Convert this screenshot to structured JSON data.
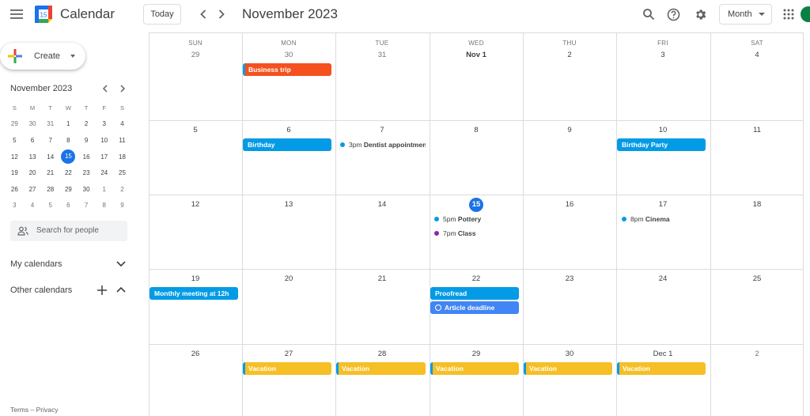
{
  "app": {
    "title": "Calendar",
    "logo_day": "15"
  },
  "toolbar": {
    "today_label": "Today",
    "period_title": "November 2023",
    "view_label": "Month"
  },
  "sidebar": {
    "create_label": "Create",
    "mini_calendar": {
      "title": "November 2023",
      "weekdays": [
        "S",
        "M",
        "T",
        "W",
        "T",
        "F",
        "S"
      ],
      "weeks": [
        [
          "29",
          "30",
          "31",
          "1",
          "2",
          "3",
          "4"
        ],
        [
          "5",
          "6",
          "7",
          "8",
          "9",
          "10",
          "11"
        ],
        [
          "12",
          "13",
          "14",
          "15",
          "16",
          "17",
          "18"
        ],
        [
          "19",
          "20",
          "21",
          "22",
          "23",
          "24",
          "25"
        ],
        [
          "26",
          "27",
          "28",
          "29",
          "30",
          "1",
          "2"
        ],
        [
          "3",
          "4",
          "5",
          "6",
          "7",
          "8",
          "9"
        ]
      ],
      "today": "15"
    },
    "search_people_placeholder": "Search for people",
    "my_calendars_label": "My calendars",
    "other_calendars_label": "Other calendars",
    "footer_terms": "Terms",
    "footer_sep": "–",
    "footer_privacy": "Privacy"
  },
  "month": {
    "weekday_headers": [
      "SUN",
      "MON",
      "TUE",
      "WED",
      "THU",
      "FRI",
      "SAT"
    ],
    "weeks": [
      [
        "29",
        "30",
        "31",
        "Nov 1",
        "2",
        "3",
        "4"
      ],
      [
        "5",
        "6",
        "7",
        "8",
        "9",
        "10",
        "11"
      ],
      [
        "12",
        "13",
        "14",
        "15",
        "16",
        "17",
        "18"
      ],
      [
        "19",
        "20",
        "21",
        "22",
        "23",
        "24",
        "25"
      ],
      [
        "26",
        "27",
        "28",
        "29",
        "30",
        "Dec 1",
        "2"
      ]
    ],
    "today_label": "15",
    "events": {
      "business_trip": "Business trip",
      "birthday": "Birthday",
      "dentist_time": "3pm",
      "dentist_title": "Dentist appointment",
      "birthday_party": "Birthday Party",
      "pottery_time": "5pm",
      "pottery_title": "Pottery",
      "class_time": "7pm",
      "class_title": "Class",
      "cinema_time": "8pm",
      "cinema_title": "Cinema",
      "monthly_meeting": "Monthly meeting at 12h",
      "proofread": "Proofread",
      "article_deadline": "Article deadline",
      "vacation": "Vacation"
    }
  },
  "colors": {
    "today_blue": "#1a73e8",
    "peacock": "#039be5",
    "tangerine": "#f4511e",
    "banana": "#f6bf26",
    "grape": "#8e24aa",
    "blueberry": "#4285f4"
  }
}
